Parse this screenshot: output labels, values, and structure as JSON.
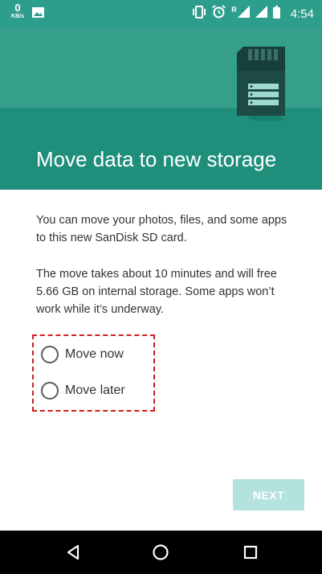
{
  "status_bar": {
    "net_speed_value": "0",
    "net_speed_unit": "KB/s",
    "network_label": "R",
    "time": "4:54",
    "icons": [
      "image-icon",
      "vibrate-icon",
      "alarm-icon",
      "wifi-icon",
      "signal-icon",
      "battery-icon"
    ]
  },
  "header": {
    "title": "Move data to new storage",
    "illustration": "sd-card-icon"
  },
  "body": {
    "paragraph1": "You can move your photos, files, and some apps to this new SanDisk SD card.",
    "paragraph2": "The move takes about 10 minutes and will free 5.66 GB on internal storage. Some apps won’t work while it’s underway."
  },
  "options": [
    {
      "label": "Move now",
      "selected": false
    },
    {
      "label": "Move later",
      "selected": false
    }
  ],
  "actions": {
    "next_label": "NEXT",
    "next_enabled": false
  },
  "nav_bar": {
    "icons": [
      "back-icon",
      "home-icon",
      "recents-icon"
    ]
  },
  "colors": {
    "header": "#359f8c",
    "header_band": "#1f8f7c",
    "status_bar": "#2e9e8c",
    "button_disabled": "#b4e2dc",
    "annotation": "#d31a1a"
  }
}
